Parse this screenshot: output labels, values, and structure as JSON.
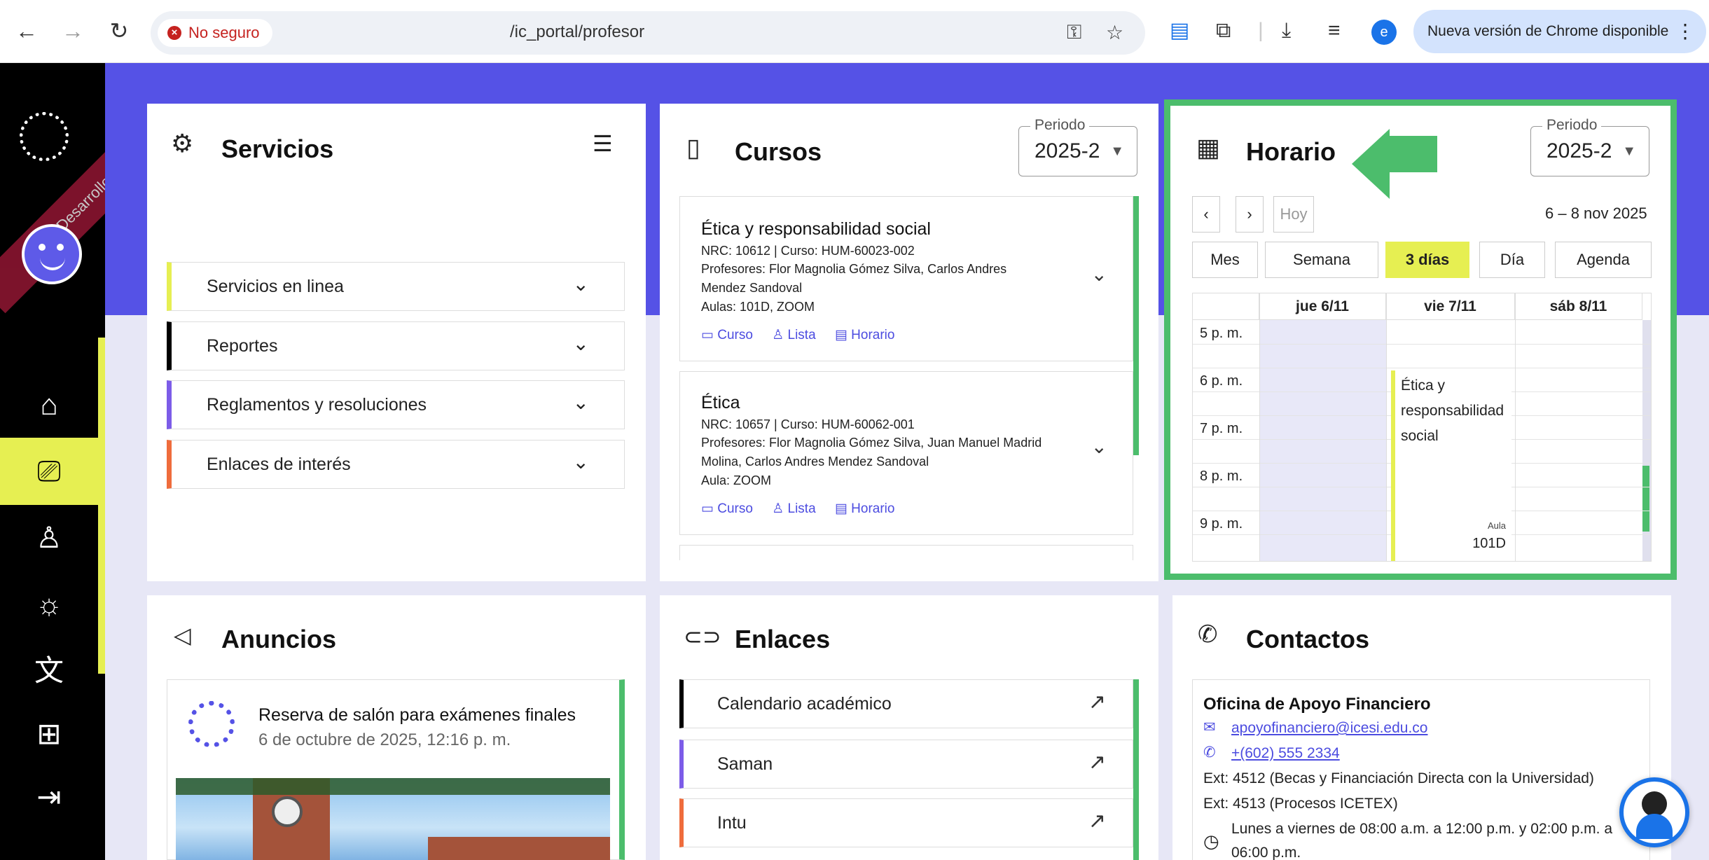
{
  "browser": {
    "insecure_label": "No seguro",
    "url": "/ic_portal/profesor",
    "update_label": "Nueva versión de Chrome disponible",
    "profile_initial": "e"
  },
  "sidebar": {
    "ribbon": "Desarrollo",
    "items": [
      "home-icon",
      "class-icon",
      "user-icon",
      "settings-icon",
      "translate-icon",
      "apps-icon",
      "logout-icon"
    ]
  },
  "servicios": {
    "title": "Servicios",
    "items": [
      {
        "label": "Servicios en linea",
        "color": "#e6ef52"
      },
      {
        "label": "Reportes",
        "color": "#000000"
      },
      {
        "label": "Reglamentos y resoluciones",
        "color": "#7c5ce8"
      },
      {
        "label": "Enlaces de interés",
        "color": "#ef6c3c"
      }
    ]
  },
  "cursos": {
    "title": "Cursos",
    "periodo_label": "Periodo",
    "periodo_value": "2025-2",
    "items": [
      {
        "name": "Ética y responsabilidad social",
        "nrc": "NRC: 10612 | Curso: HUM-60023-002",
        "profesores": "Profesores: Flor Magnolia Gómez Silva, Carlos Andres Mendez Sandoval",
        "aulas": "Aulas: 101D, ZOOM"
      },
      {
        "name": "Ética",
        "nrc": "NRC: 10657 | Curso: HUM-60062-001",
        "profesores": "Profesores: Flor Magnolia Gómez Silva, Juan Manuel Madrid Molina, Carlos Andres Mendez Sandoval",
        "aulas": "Aula: ZOOM"
      }
    ],
    "link_curso": "Curso",
    "link_lista": "Lista",
    "link_horario": "Horario"
  },
  "horario": {
    "title": "Horario",
    "periodo_label": "Periodo",
    "periodo_value": "2025-2",
    "today_label": "Hoy",
    "range": "6 – 8 nov 2025",
    "views": [
      "Mes",
      "Semana",
      "3 días",
      "Día",
      "Agenda"
    ],
    "active_view": "3 días",
    "days": [
      "jue 6/11",
      "vie 7/11",
      "sáb 8/11"
    ],
    "times": [
      "5 p. m.",
      "6 p. m.",
      "7 p. m.",
      "8 p. m.",
      "9 p. m."
    ],
    "event": {
      "title": "Ética y responsabilidad social",
      "aula_label": "Aula",
      "aula": "101D"
    },
    "highlight_color": "#4cbd6c"
  },
  "anuncios": {
    "title": "Anuncios",
    "item_title": "Reserva de salón para exámenes finales",
    "item_date": "6 de octubre de 2025, 12:16 p. m."
  },
  "enlaces": {
    "title": "Enlaces",
    "items": [
      {
        "label": "Calendario académico",
        "color": "#000000"
      },
      {
        "label": "Saman",
        "color": "#7c5ce8"
      },
      {
        "label": "Intu",
        "color": "#ef6c3c"
      }
    ]
  },
  "contactos": {
    "title": "Contactos",
    "office": "Oficina de Apoyo Financiero",
    "email": "apoyofinanciero@icesi.edu.co",
    "phone": "+(602) 555 2334",
    "ext1": "Ext: 4512 (Becas y Financiación Directa con la Universidad)",
    "ext2": "Ext: 4513 (Procesos ICETEX)",
    "hours1": "Lunes a viernes de 08:00 a.m. a 12:00 p.m. y 02:00 p.m. a",
    "hours2": "06:00 p.m."
  }
}
